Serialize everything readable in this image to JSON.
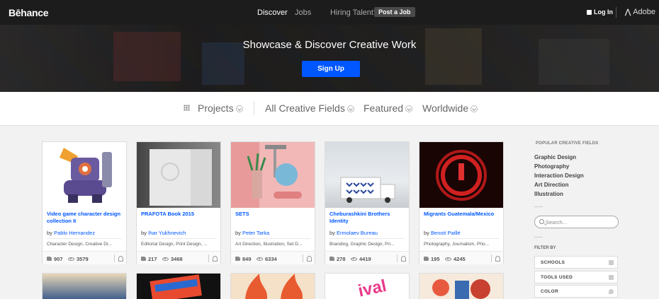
{
  "nav": {
    "logo": "Bēhance",
    "discover": "Discover",
    "jobs": "Jobs",
    "hiring": "Hiring Talent?",
    "post_job": "Post a Job",
    "login": "Log In",
    "adobe": "Adobe"
  },
  "hero": {
    "title": "Showcase & Discover Creative Work",
    "signup": "Sign Up"
  },
  "filters": {
    "projects": "Projects",
    "fields": "All Creative Fields",
    "featured": "Featured",
    "worldwide": "Worldwide"
  },
  "cards": [
    {
      "title": "Video game character design collection II",
      "by": "by",
      "author": "Pablo Hernandez",
      "fields": "Character Design, Creative Di...",
      "likes": "907",
      "views": "3579"
    },
    {
      "title": "PRAFOTA Book 2015",
      "by": "by",
      "author": "Ihar Yukhnevich",
      "fields": "Editorial Design, Print Design, ...",
      "likes": "217",
      "views": "3468"
    },
    {
      "title": "SETS",
      "by": "by",
      "author": "Peter Tarka",
      "fields": "Art Direction, Illustration, Set D...",
      "likes": "849",
      "views": "6334"
    },
    {
      "title": "Cheburashkini Brothers Identity",
      "by": "by",
      "author": "Ermolaev Bureau",
      "fields": "Branding, Graphic Design, Pri...",
      "likes": "278",
      "views": "4419"
    },
    {
      "title": "Migrants Guatemala/Mexico",
      "by": "by",
      "author": "Benoit Paillé",
      "fields": "Photography, Journalism, Pho...",
      "likes": "195",
      "views": "4245"
    }
  ],
  "sidebar": {
    "popular_heading": "POPULAR CREATIVE FIELDS",
    "popular": [
      "Graphic Design",
      "Photography",
      "Interaction Design",
      "Art Direction",
      "Illustration"
    ],
    "search_placeholder": "Search...",
    "filter_by": "FILTER BY",
    "filter_options": [
      "SCHOOLS",
      "TOOLS USED",
      "COLOR"
    ]
  }
}
